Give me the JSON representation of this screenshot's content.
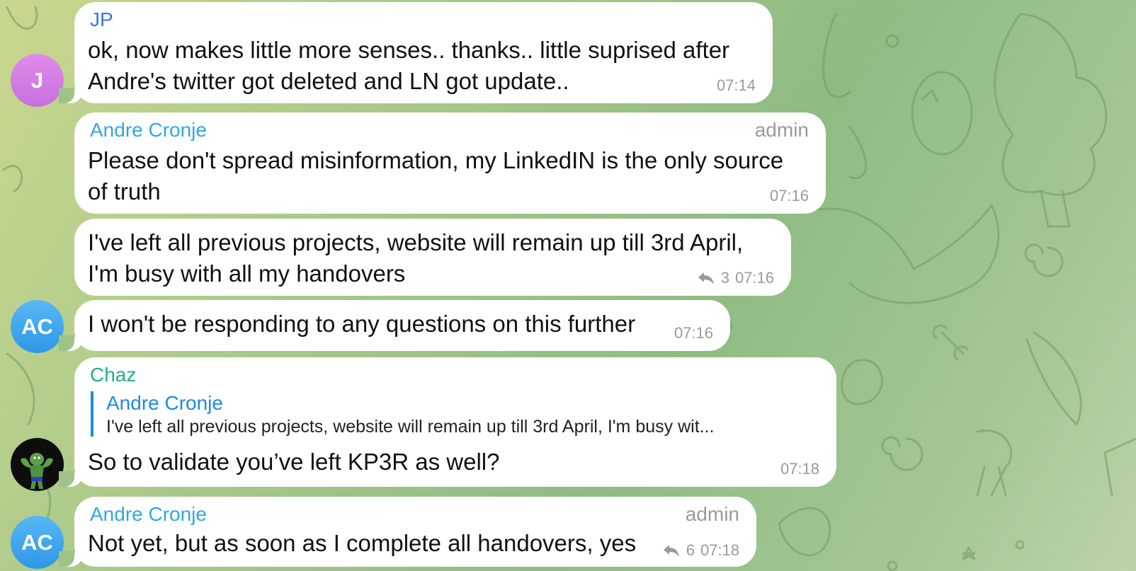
{
  "colors": {
    "jp_name": "#3b78e0",
    "andre_name": "#2fa8e3",
    "chaz_name": "#1fae8a",
    "reply_accent": "#1a8ae6",
    "bubble": "#ffffff",
    "meta_text": "#9a9a9a"
  },
  "messages": [
    {
      "sender": "JP",
      "lines": [
        "ok, now makes little more senses.. thanks.. little suprised after",
        "Andre's twitter got deleted and LN got update.."
      ],
      "time": "07:14"
    },
    {
      "sender": "Andre Cronje",
      "role": "admin",
      "lines": [
        "Please don't spread misinformation, my LinkedIN is the only source",
        "of truth"
      ],
      "time": "07:16"
    },
    {
      "lines": [
        "I've left all previous projects, website will remain up till 3rd April,",
        "I'm busy with all my handovers"
      ],
      "replies": "3",
      "time": "07:16"
    },
    {
      "lines": [
        "I won't be responding to any questions on this further"
      ],
      "time": "07:16"
    },
    {
      "sender": "Chaz",
      "reply_to": {
        "name": "Andre Cronje",
        "text": "I've left all previous projects, website will remain up till 3rd April, I'm busy wit..."
      },
      "lines": [
        "So to validate you’ve left KP3R as well?"
      ],
      "time": "07:18"
    },
    {
      "sender": "Andre Cronje",
      "role": "admin",
      "lines": [
        "Not yet, but as soon as I complete all handovers, yes"
      ],
      "replies": "6",
      "time": "07:18"
    }
  ],
  "avatars": [
    {
      "initials": "J",
      "icon": "user-initials-avatar",
      "color": "#d57ce6"
    },
    {
      "initials": "AC",
      "icon": "user-initials-avatar",
      "color": "#3fa7ee"
    },
    {
      "icon": "pepe-flexing-avatar"
    },
    {
      "initials": "AC",
      "icon": "user-initials-avatar",
      "color": "#3fa7ee"
    }
  ]
}
